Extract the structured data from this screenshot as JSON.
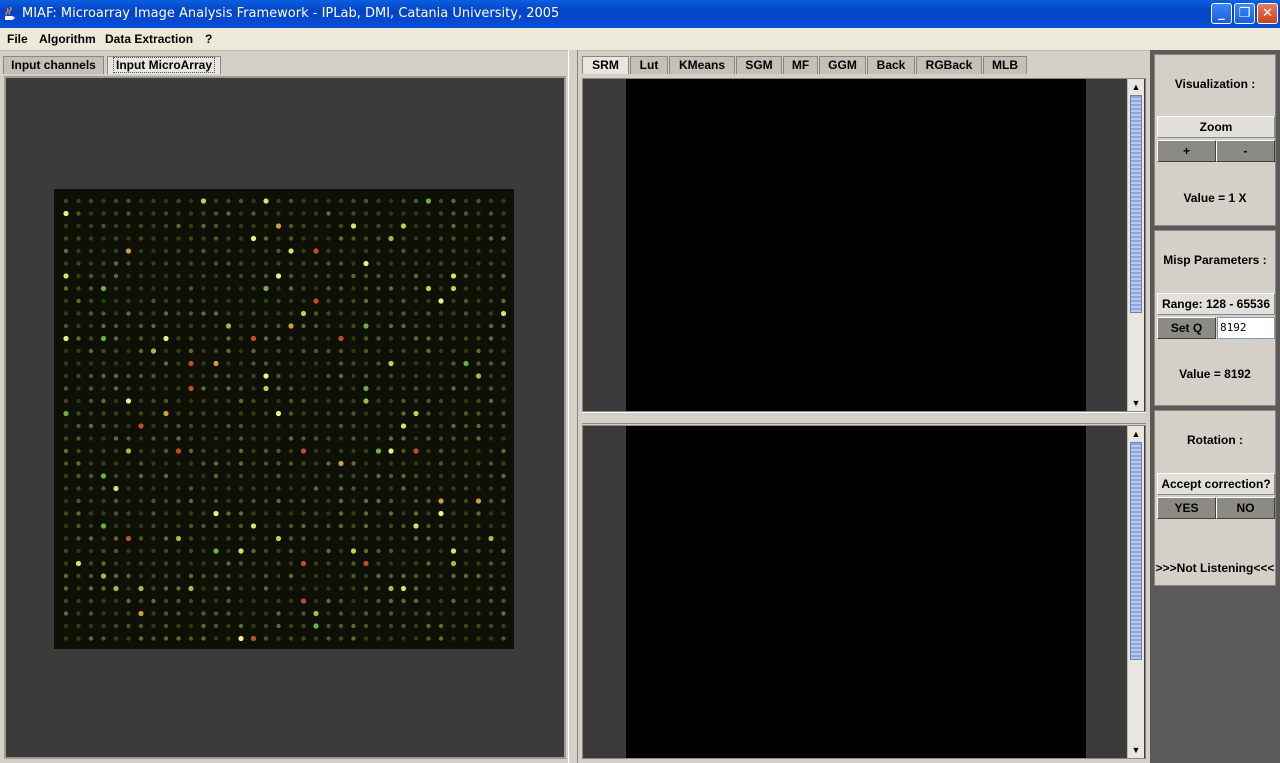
{
  "window": {
    "title": "MIAF: Microarray Image Analysis Framework  -  IPLab, DMI, Catania University, 2005",
    "minimize_glyph": "_",
    "maximize_glyph": "❐",
    "close_glyph": "✕"
  },
  "menu": {
    "items": [
      "File",
      "Algorithm",
      "Data Extraction",
      "?"
    ]
  },
  "left_tabs": [
    "Input channels",
    "Input MicroArray"
  ],
  "left_selected_tab": "Input MicroArray",
  "right_tabs": [
    "SRM",
    "Lut",
    "KMeans",
    "SGM",
    "MF",
    "GGM",
    "Back",
    "RGBack",
    "MLB"
  ],
  "right_selected_tab": "SRM",
  "controls": {
    "visualization": {
      "heading": "Visualization :",
      "zoom_label": "Zoom",
      "plus_label": "+",
      "minus_label": "-",
      "value_text": "Value = 1 X"
    },
    "misp": {
      "heading": "Misp Parameters :",
      "range_text": "Range: 128 - 65536",
      "setq_label": "Set Q",
      "q_value": "8192",
      "value_text": "Value = 8192"
    },
    "rotation": {
      "heading": "Rotation :",
      "accept_text": "Accept correction?",
      "yes_label": "YES",
      "no_label": "NO",
      "status_text": ">>>Not Listening<<<"
    }
  },
  "icons": {
    "app": "java-coffee-icon",
    "scroll_up": "arrow-up-icon",
    "scroll_down": "arrow-down-icon"
  },
  "colors": {
    "titlebar": "#0343c4",
    "panel_bg": "#3b3b3b",
    "canvas": "#000000",
    "microarray_bg": "#0e1006"
  }
}
